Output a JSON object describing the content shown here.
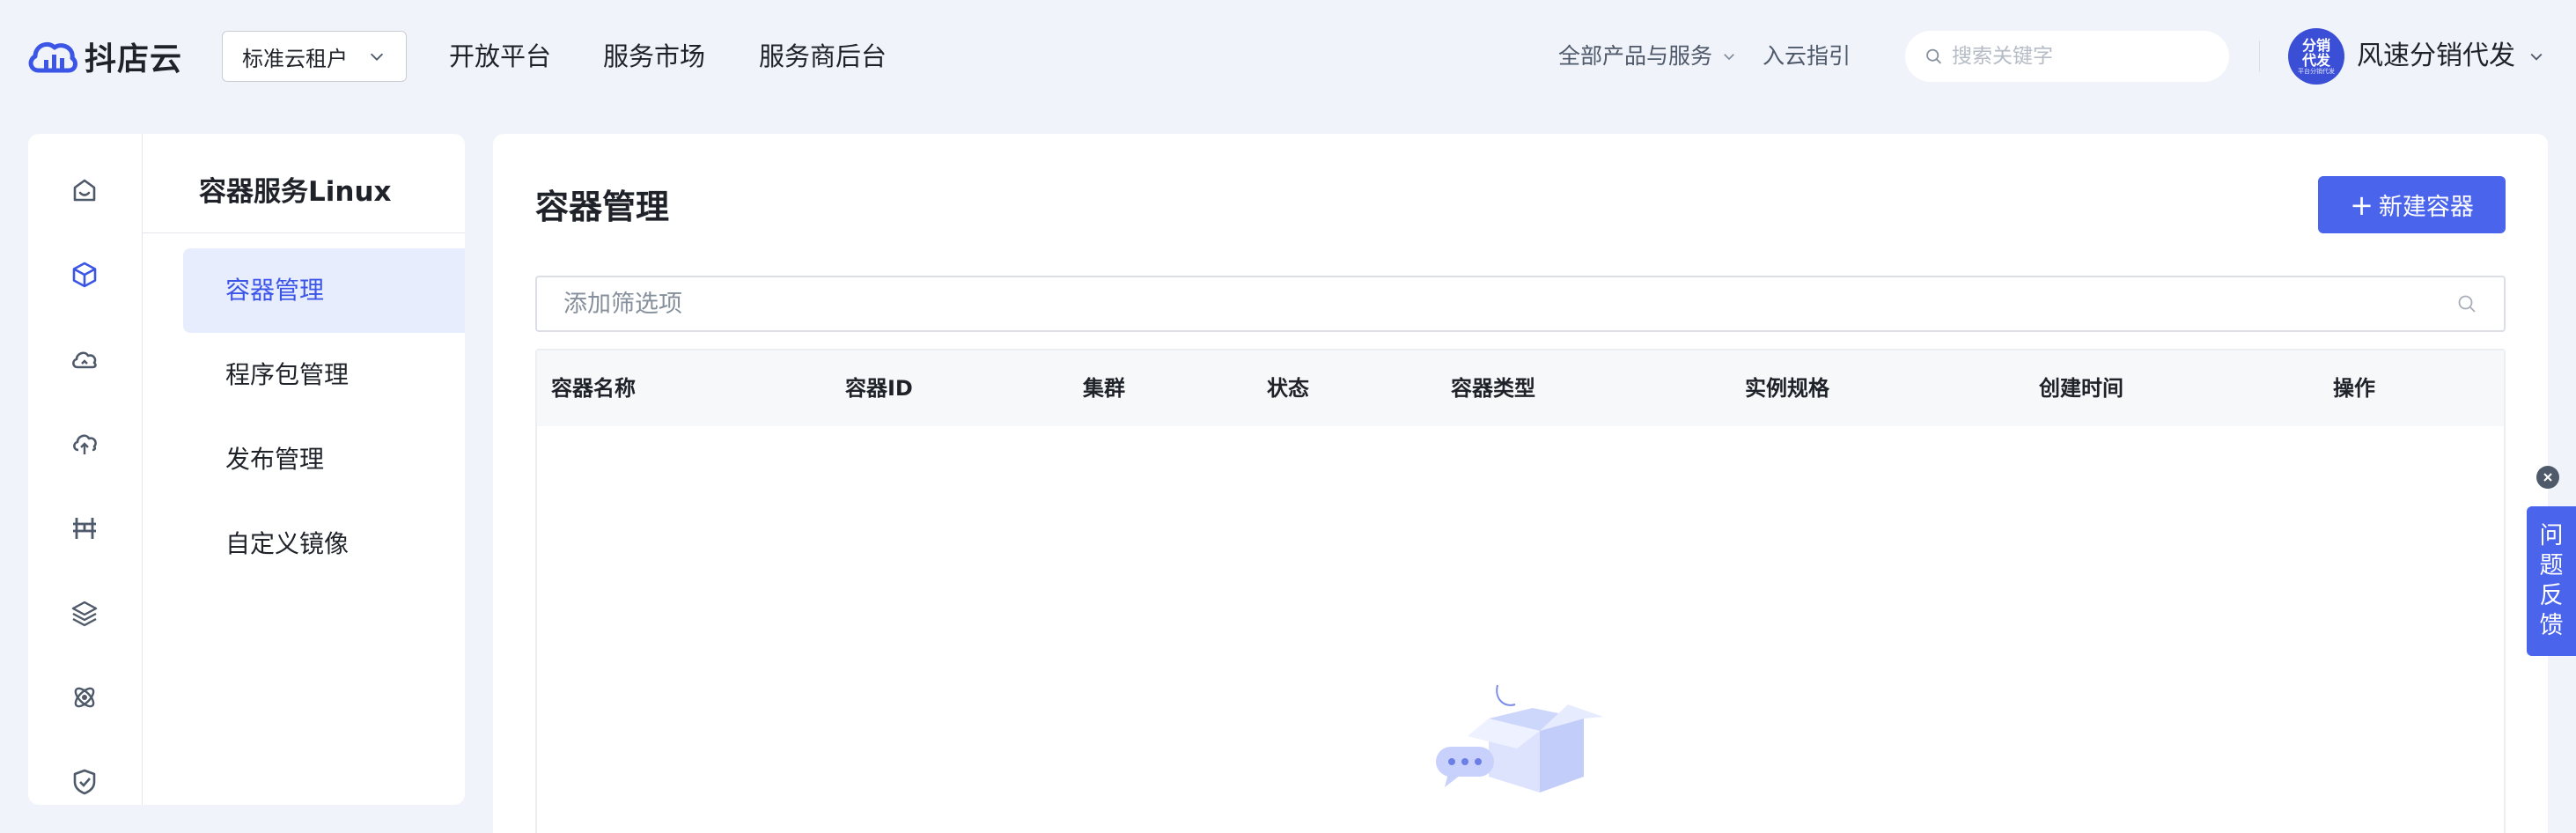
{
  "header": {
    "brand": "抖店云",
    "tenant_select": "标准云租户",
    "nav": [
      "开放平台",
      "服务市场",
      "服务商后台"
    ],
    "all_products": "全部产品与服务",
    "guide": "入云指引",
    "search_placeholder": "搜索关键字",
    "user": {
      "avatar_line1": "分销",
      "avatar_line2": "代发",
      "avatar_small": "平台分销代发",
      "name": "风速分销代发"
    }
  },
  "rail_icons": [
    "home-icon",
    "cube-icon",
    "cloud-icon",
    "cloud-upload-icon",
    "gate-icon",
    "layers-icon",
    "orbit-icon",
    "shield-check-icon"
  ],
  "sidebar": {
    "title": "容器服务Linux",
    "items": [
      {
        "label": "容器管理",
        "active": true
      },
      {
        "label": "程序包管理",
        "active": false
      },
      {
        "label": "发布管理",
        "active": false
      },
      {
        "label": "自定义镜像",
        "active": false
      }
    ]
  },
  "main": {
    "title": "容器管理",
    "new_button": "新建容器",
    "filter_placeholder": "添加筛选项",
    "columns": [
      "容器名称",
      "容器ID",
      "集群",
      "状态",
      "容器类型",
      "实例规格",
      "创建时间",
      "操作"
    ]
  },
  "feedback": {
    "chars": [
      "问",
      "题",
      "反",
      "馈"
    ]
  },
  "colors": {
    "accent": "#4b64ec",
    "active_bg": "#e8edfe",
    "page_bg": "#f1f3fa"
  }
}
